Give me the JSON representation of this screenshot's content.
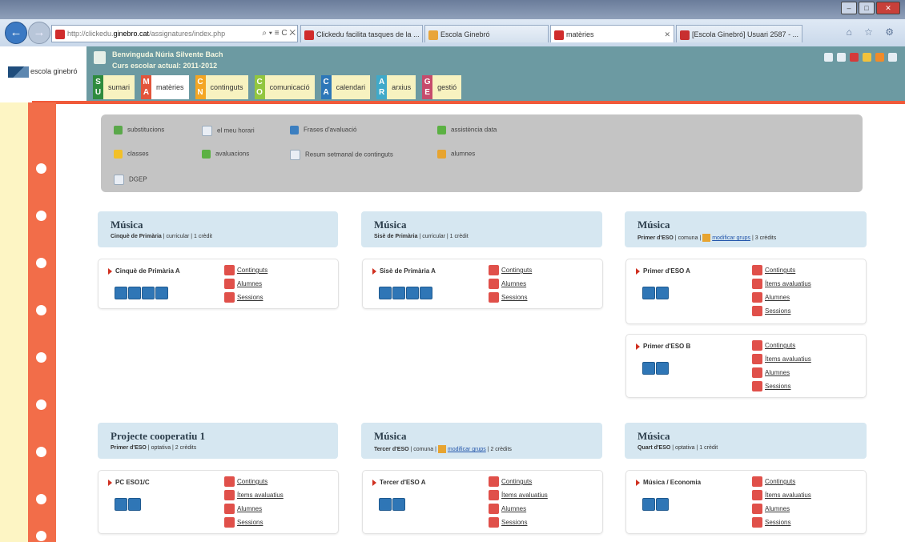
{
  "browser": {
    "address_fav": "C",
    "url_pre": "http://clickedu.",
    "url_domain": "ginebro.cat",
    "url_post": "/assignatures/index.php",
    "addr_controls": "⌕ ▾ ≡ C ✕",
    "tabs": [
      {
        "label": "Clickedu facilita tasques de la ...",
        "color": "#d02c2c"
      },
      {
        "label": "Escola Ginebró",
        "color": "#e8a53a"
      },
      {
        "label": "matèries",
        "color": "#d02c2c",
        "close": "✕"
      },
      {
        "label": "[Escola Ginebró] Usuari 2587 - ...",
        "color": "#c83030"
      }
    ],
    "right_icons": "⌂ ☆ ⚙",
    "win_buttons": [
      "–",
      "□",
      "✕"
    ]
  },
  "header": {
    "logo_text": "escola ginebró",
    "welcome": "Benvinguda Núria Silvente Bach",
    "year": "Curs escolar actual: 2011-2012",
    "menu": [
      {
        "l1": "S",
        "l2": "U",
        "label": "sumari",
        "color": "#2e8b3e"
      },
      {
        "l1": "M",
        "l2": "A",
        "label": "matèries",
        "color": "#e2553b",
        "active": true
      },
      {
        "l1": "C",
        "l2": "N",
        "label": "continguts",
        "color": "#f4a623"
      },
      {
        "l1": "C",
        "l2": "O",
        "label": "comunicació",
        "color": "#92c63f"
      },
      {
        "l1": "C",
        "l2": "A",
        "label": "calendari",
        "color": "#2d77b8"
      },
      {
        "l1": "A",
        "l2": "R",
        "label": "arxius",
        "color": "#3fa9c9"
      },
      {
        "l1": "G",
        "l2": "E",
        "label": "gestió",
        "color": "#c64b6c"
      }
    ]
  },
  "shortcuts": [
    "substitucions",
    "el meu horari",
    "Frases d'avaluació",
    "assistència data",
    "classes",
    "avaluacions",
    "Resum setmanal de continguts",
    "alumnes",
    "DGEP"
  ],
  "subjects": [
    {
      "title": "Música",
      "level": "Cinquè de Primària",
      "meta": " | curricular | 1 crèdit",
      "link": "",
      "meta2": ""
    },
    {
      "title": "Música",
      "level": "Sisè de Primària",
      "meta": " | curricular | 1 crèdit",
      "link": "",
      "meta2": ""
    },
    {
      "title": "Música",
      "level": "Primer d'ESO",
      "meta": " | comuna | ",
      "link": "modificar grups",
      "meta2": " | 3 crèdits"
    },
    {
      "title": "Projecte cooperatiu 1",
      "level": "Primer d'ESO",
      "meta": " | optativa | 2 crèdits",
      "link": "",
      "meta2": ""
    },
    {
      "title": "Música",
      "level": "Tercer d'ESO",
      "meta": " | comuna | ",
      "link": "modificar grups",
      "meta2": " | 2 crèdits"
    },
    {
      "title": "Música",
      "level": "Quart d'ESO",
      "meta": " | optativa | 1 crèdit",
      "link": "",
      "meta2": ""
    }
  ],
  "groups": [
    {
      "name": "Cinquè de Primària A",
      "links": [
        "Continguts",
        "Alumnes",
        "Sessions"
      ]
    },
    {
      "name": "Sisè de Primària A",
      "links": [
        "Continguts",
        "Alumnes",
        "Sessions"
      ]
    },
    {
      "name": "Primer d'ESO A",
      "links": [
        "Continguts",
        "Ítems avaluatius",
        "Alumnes",
        "Sessions"
      ]
    },
    {
      "name": "Primer d'ESO B",
      "links": [
        "Continguts",
        "Ítems avaluatius",
        "Alumnes",
        "Sessions"
      ]
    },
    {
      "name": "PC ESO1/C",
      "links": [
        "Continguts",
        "Ítems avaluatius",
        "Alumnes",
        "Sessions"
      ]
    },
    {
      "name": "Tercer d'ESO A",
      "links": [
        "Continguts",
        "Ítems avaluatius",
        "Alumnes",
        "Sessions"
      ]
    },
    {
      "name": "Música / Economia",
      "links": [
        "Continguts",
        "Ítems avaluatius",
        "Alumnes",
        "Sessions"
      ]
    }
  ]
}
